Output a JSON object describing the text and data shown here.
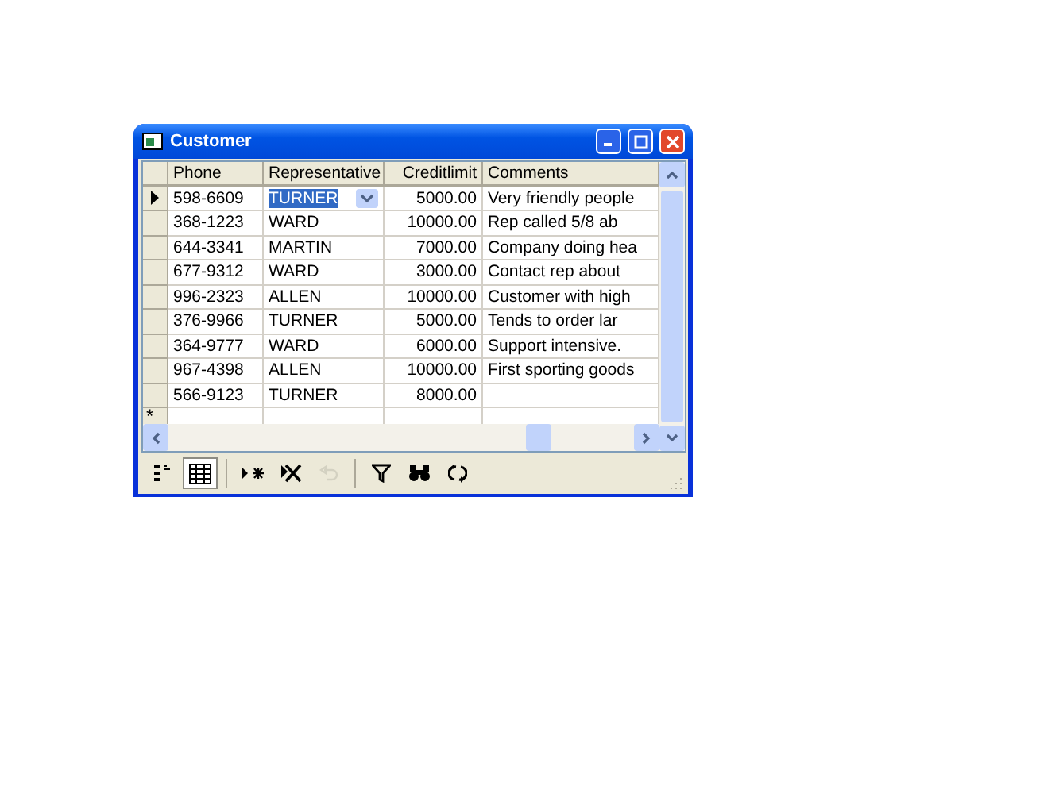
{
  "window": {
    "title": "Customer"
  },
  "table": {
    "columns": [
      "Phone",
      "Representative",
      "Creditlimit",
      "Comments"
    ],
    "rows": [
      {
        "current": true,
        "cells": [
          "598-6609",
          "TURNER",
          "5000.00",
          "Very friendly people"
        ]
      },
      {
        "current": false,
        "cells": [
          "368-1223",
          "WARD",
          "10000.00",
          "Rep called 5/8 ab"
        ]
      },
      {
        "current": false,
        "cells": [
          "644-3341",
          "MARTIN",
          "7000.00",
          "Company doing hea"
        ]
      },
      {
        "current": false,
        "cells": [
          "677-9312",
          "WARD",
          "3000.00",
          "Contact rep about"
        ]
      },
      {
        "current": false,
        "cells": [
          "996-2323",
          "ALLEN",
          "10000.00",
          "Customer with high"
        ]
      },
      {
        "current": false,
        "cells": [
          "376-9966",
          "TURNER",
          "5000.00",
          "Tends to order lar"
        ]
      },
      {
        "current": false,
        "cells": [
          "364-9777",
          "WARD",
          "6000.00",
          "Support intensive."
        ]
      },
      {
        "current": false,
        "cells": [
          "967-4398",
          "ALLEN",
          "10000.00",
          "First sporting goods"
        ]
      },
      {
        "current": false,
        "cells": [
          "566-9123",
          "TURNER",
          "8000.00",
          ""
        ]
      }
    ],
    "new_row_marker": "*"
  },
  "toolbar": [
    {
      "kind": "form-view",
      "selected": false,
      "disabled": false
    },
    {
      "kind": "grid-view",
      "selected": true,
      "disabled": false
    },
    {
      "kind": "separator"
    },
    {
      "kind": "add-row",
      "selected": false,
      "disabled": false
    },
    {
      "kind": "delete-row",
      "selected": false,
      "disabled": false
    },
    {
      "kind": "undo",
      "selected": false,
      "disabled": true
    },
    {
      "kind": "separator"
    },
    {
      "kind": "filter",
      "selected": false,
      "disabled": false
    },
    {
      "kind": "find",
      "selected": false,
      "disabled": false
    },
    {
      "kind": "refresh",
      "selected": false,
      "disabled": false
    }
  ]
}
